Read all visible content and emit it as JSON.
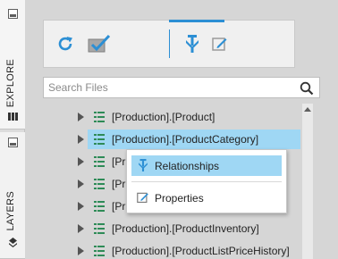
{
  "sidebar": {
    "tabs": [
      {
        "label": "EXPLORE"
      },
      {
        "label": "LAYERS"
      }
    ]
  },
  "toolbar": {
    "buttons": [
      {
        "icon": "refresh-icon"
      },
      {
        "icon": "check-icon"
      },
      {
        "icon": "relationships-icon"
      },
      {
        "icon": "edit-icon"
      }
    ]
  },
  "search": {
    "placeholder": "Search Files"
  },
  "tree": {
    "rows": [
      {
        "label": "[Production].[Product]"
      },
      {
        "label": "[Production].[ProductCategory]",
        "selected": true
      },
      {
        "label": "[Pr"
      },
      {
        "label": "[Pr"
      },
      {
        "label": "[Pr"
      },
      {
        "label": "[Production].[ProductInventory]"
      },
      {
        "label": "[Production].[ProductListPriceHistory]"
      }
    ]
  },
  "context_menu": {
    "items": [
      {
        "label": "Relationships",
        "icon": "relationships-icon",
        "highlighted": true
      },
      {
        "label": "Properties",
        "icon": "properties-icon"
      }
    ]
  },
  "colors": {
    "accent": "#2c8fd4",
    "selection": "#9fd7f4",
    "panel_bg": "#d6d6d6"
  }
}
